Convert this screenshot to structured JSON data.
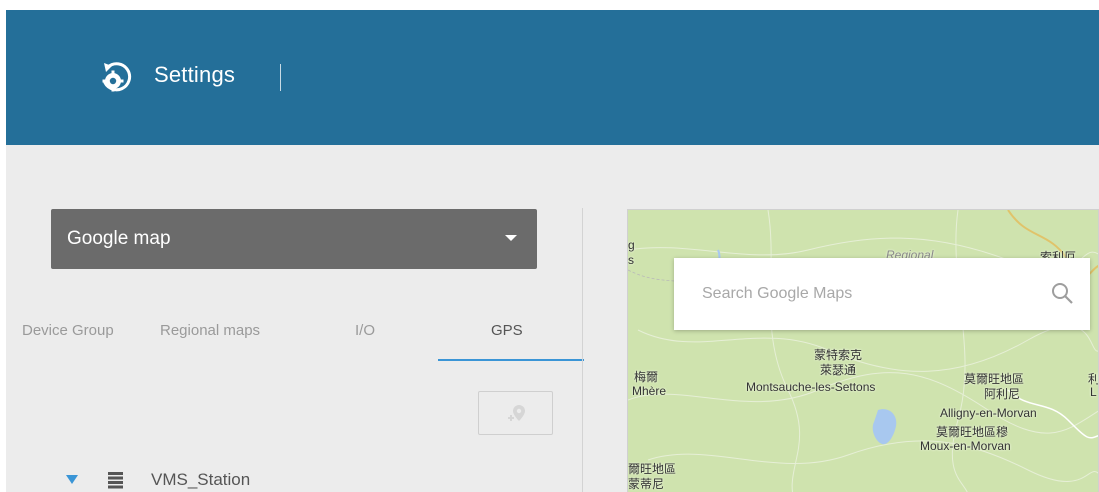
{
  "header": {
    "title": "Settings",
    "icon": "settings-gear-icon",
    "background": "#246f99"
  },
  "map_type_select": {
    "value": "Google map",
    "icon": "caret-down-icon"
  },
  "tabs": [
    {
      "label": "Device Group",
      "active": false
    },
    {
      "label": "Regional maps",
      "active": false
    },
    {
      "label": "I/O",
      "active": false
    },
    {
      "label": "GPS",
      "active": true
    }
  ],
  "accent_color": "#3a95d6",
  "toolbar": {
    "add_location_icon": "map-pin-add-icon"
  },
  "tree": {
    "items": [
      {
        "label": "VMS_Station",
        "icon": "server-icon",
        "expanded": true
      }
    ]
  },
  "map": {
    "search_placeholder": "Search Google Maps",
    "search_icon": "search-icon",
    "labels": {
      "top_left_fragment_1": "g",
      "top_left_fragment_2": "s",
      "regional": "Regional",
      "top_right_chinese": "索利厄",
      "chinese_1": "蒙特索克",
      "chinese_2": "萊瑟通",
      "montsauche": "Montsauche-les-Settons",
      "chinese_left": "梅爾",
      "mhere": "Mhère",
      "chinese_right_1": "莫爾旺地區",
      "chinese_right_2": "阿利尼",
      "alligny": "Alligny-en-Morvan",
      "chinese_right_3": "莫爾旺地區穆",
      "moux": "Moux-en-Morvan",
      "chinese_bottom_1": "爾旺地區",
      "chinese_bottom_2": "蒙蒂尼",
      "edge_char": "利",
      "edge_letter": "L"
    }
  }
}
